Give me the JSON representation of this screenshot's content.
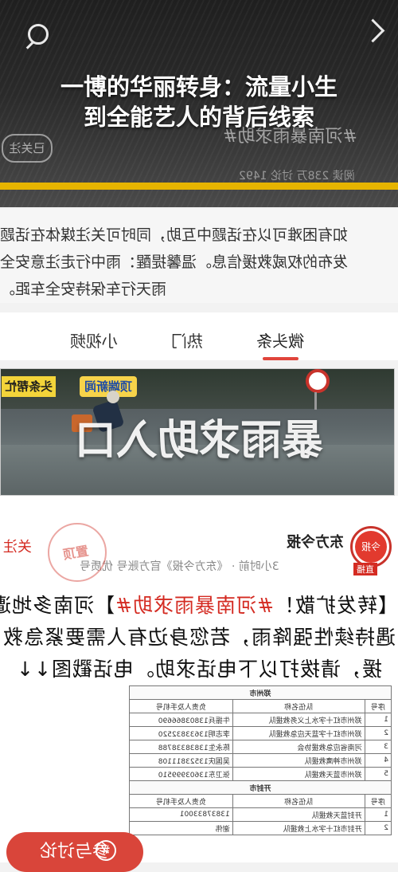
{
  "header": {
    "headline_lines": [
      "一博的华丽转身：流量小生",
      "到全能艺人的背后线索"
    ],
    "topic_ghost": "#河南暴雨求助#",
    "followed_ghost": "已关注",
    "stats_ghost": "阅读 238万  讨论 1492"
  },
  "intro": {
    "lines": [
      "如有困难可以在话题中互助，同时可关注媒体在话题",
      "发布的权威救援信息。温馨提醒：雨中行走注意安全",
      "雨天行车保持安全车距。"
    ]
  },
  "tabs": [
    {
      "label": "微头条",
      "active": true
    },
    {
      "label": "热门",
      "active": false
    },
    {
      "label": "小视频",
      "active": false
    }
  ],
  "banner": {
    "title": "暴雨求助入口",
    "logo_brand": "头条帮忙",
    "logo_news": "顶端新闻"
  },
  "post": {
    "author": "东方今报",
    "avatar_text": "今报",
    "live_badge": "直播",
    "meta": "3小时前 · 《东方今报》官方账号 优质号",
    "follow_label": "关注",
    "seal_text": "置顶",
    "body": {
      "line1_prefix": "【转发扩散！",
      "line1_tag": "#河南暴雨求助#",
      "line1_suffix": "】河南多地遭",
      "line2": "遇持续性强降雨，若您身边有人需要紧急救",
      "line3": "援，请拨打以下电话求助。电话戳图↓↓"
    },
    "table": {
      "section1": "郑州市",
      "section2": "开封市",
      "headers": [
        "序号",
        "队伍名称",
        "负责人及手机号"
      ],
      "rows1": [
        [
          "1",
          "郑州市红十字水上义务救援队",
          "牛振兵13803866690"
        ],
        [
          "2",
          "郑州市红十字蓝天应急救援队",
          "李志明13633832520"
        ],
        [
          "3",
          "河南省应急救援协会",
          "陈永生13838338788"
        ],
        [
          "4",
          "郑州市神鹰救援队",
          "吴国庆13523811108"
        ],
        [
          "5",
          "郑州市蓝天救援队",
          "张卫东13603999510"
        ]
      ],
      "rows2": [
        [
          "1",
          "开封蓝天救援队",
          "13837833001"
        ],
        [
          "2",
          "开封市红十字水上救援队",
          "谢伟"
        ]
      ]
    }
  },
  "actions": {
    "discuss_label": "参与讨论",
    "discuss_icon": "#"
  }
}
